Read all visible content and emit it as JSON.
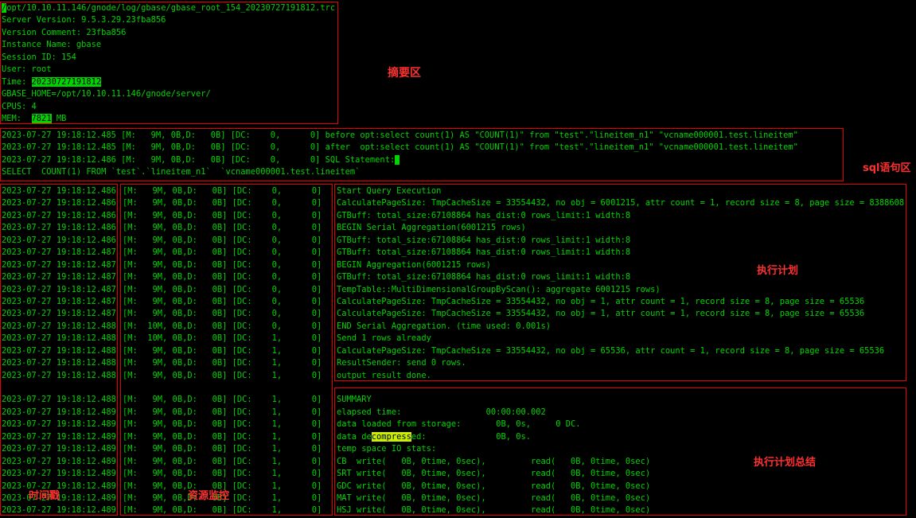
{
  "colors": {
    "bg": "#000000",
    "fg": "#00d400",
    "annotation": "#ff3030",
    "box": "#e80000",
    "highlight": "#c8f000"
  },
  "annotations": {
    "summary_area": "摘要区",
    "sql_area": "sql语句区",
    "exec_plan": "执行计划",
    "exec_plan_summary": "执行计划总结",
    "timestamp": "时间戳",
    "resource_monitor": "资源监控"
  },
  "header": {
    "lines": [
      {
        "segs": [
          [
            "/",
            "inv"
          ],
          [
            "opt/10.10.11.146/gnode/log/gbase/gbase_root_154_20230727191812.trc",
            ""
          ]
        ]
      },
      "Server Version: 9.5.3.29.23fba856",
      "Version Comment: 23fba856",
      "Instance Name: gbase",
      "Session ID: 154",
      "User: root",
      {
        "segs": [
          [
            "Time: ",
            ""
          ],
          [
            "20230727191812",
            "inv"
          ]
        ]
      },
      "GBASE_HOME=/opt/10.10.11.146/gnode/server/",
      "CPUS: 4",
      {
        "segs": [
          [
            "MEM:  ",
            ""
          ],
          [
            "7821",
            "inv"
          ],
          [
            " MB",
            ""
          ]
        ]
      }
    ]
  },
  "sql": {
    "lines": [
      "2023-07-27 19:18:12.485 [M:   9M, 0B,D:   0B] [DC:    0,      0] before opt:select count(1) AS \"COUNT(1)\" from \"test\".\"lineitem_n1\" \"vcname000001.test.lineitem\"",
      "2023-07-27 19:18:12.485 [M:   9M, 0B,D:   0B] [DC:    0,      0] after  opt:select count(1) AS \"COUNT(1)\" from \"test\".\"lineitem_n1\" \"vcname000001.test.lineitem\"",
      {
        "segs": [
          [
            "2023-07-27 19:18:12.486 [M:   9M, 0B,D:   0B] [DC:    0,      0] SQL Statement:",
            ""
          ],
          [
            " ",
            "inv"
          ]
        ]
      },
      "SELECT  COUNT(1) FROM `test`.`lineitem_n1`  `vcname000001.test.lineitem`"
    ]
  },
  "log": {
    "rows": [
      {
        "ts": "2023-07-27 19:18:12.486",
        "res": "[M:   9M, 0B,D:   0B] [DC:    0,      0]",
        "msg": "Start Query Execution"
      },
      {
        "ts": "2023-07-27 19:18:12.486",
        "res": "[M:   9M, 0B,D:   0B] [DC:    0,      0]",
        "msg": "CalculatePageSize: TmpCacheSize = 33554432, no obj = 6001215, attr count = 1, record size = 8, page size = 8388608"
      },
      {
        "ts": "2023-07-27 19:18:12.486",
        "res": "[M:   9M, 0B,D:   0B] [DC:    0,      0]",
        "msg": "GTBuff: total_size:67108864 has_dist:0 rows_limit:1 width:8"
      },
      {
        "ts": "2023-07-27 19:18:12.486",
        "res": "[M:   9M, 0B,D:   0B] [DC:    0,      0]",
        "msg": "BEGIN Serial Aggregation(6001215 rows)"
      },
      {
        "ts": "2023-07-27 19:18:12.486",
        "res": "[M:   9M, 0B,D:   0B] [DC:    0,      0]",
        "msg": "GTBuff: total_size:67108864 has_dist:0 rows_limit:1 width:8"
      },
      {
        "ts": "2023-07-27 19:18:12.487",
        "res": "[M:   9M, 0B,D:   0B] [DC:    0,      0]",
        "msg": "GTBuff: total_size:67108864 has_dist:0 rows_limit:1 width:8"
      },
      {
        "ts": "2023-07-27 19:18:12.487",
        "res": "[M:   9M, 0B,D:   0B] [DC:    0,      0]",
        "msg": "BEGIN Aggregation(6001215 rows)"
      },
      {
        "ts": "2023-07-27 19:18:12.487",
        "res": "[M:   9M, 0B,D:   0B] [DC:    0,      0]",
        "msg": "GTBuff: total_size:67108864 has_dist:0 rows_limit:1 width:8"
      },
      {
        "ts": "2023-07-27 19:18:12.487",
        "res": "[M:   9M, 0B,D:   0B] [DC:    0,      0]",
        "msg": "TempTable::MultiDimensionalGroupByScan(): aggregate 6001215 rows)"
      },
      {
        "ts": "2023-07-27 19:18:12.487",
        "res": "[M:   9M, 0B,D:   0B] [DC:    0,      0]",
        "msg": "CalculatePageSize: TmpCacheSize = 33554432, no obj = 1, attr count = 1, record size = 8, page size = 65536"
      },
      {
        "ts": "2023-07-27 19:18:12.487",
        "res": "[M:   9M, 0B,D:   0B] [DC:    0,      0]",
        "msg": "CalculatePageSize: TmpCacheSize = 33554432, no obj = 1, attr count = 1, record size = 8, page size = 65536"
      },
      {
        "ts": "2023-07-27 19:18:12.488",
        "res": "[M:  10M, 0B,D:   0B] [DC:    0,      0]",
        "msg": "END Serial Aggregation. (time used: 0.001s)"
      },
      {
        "ts": "2023-07-27 19:18:12.488",
        "res": "[M:  10M, 0B,D:   0B] [DC:    1,      0]",
        "msg": "Send 1 rows already"
      },
      {
        "ts": "2023-07-27 19:18:12.488",
        "res": "[M:   9M, 0B,D:   0B] [DC:    1,      0]",
        "msg": "CalculatePageSize: TmpCacheSize = 33554432, no obj = 65536, attr count = 1, record size = 8, page size = 65536"
      },
      {
        "ts": "2023-07-27 19:18:12.488",
        "res": "[M:   9M, 0B,D:   0B] [DC:    1,      0]",
        "msg": "ResultSender: send 0 rows."
      },
      {
        "ts": "2023-07-27 19:18:12.488",
        "res": "[M:   9M, 0B,D:   0B] [DC:    1,      0]",
        "msg": "output result done."
      },
      {
        "ts": "",
        "res": "",
        "msg": ""
      },
      {
        "ts": "2023-07-27 19:18:12.488",
        "res": "[M:   9M, 0B,D:   0B] [DC:    1,      0]",
        "msg": "SUMMARY"
      },
      {
        "ts": "2023-07-27 19:18:12.489",
        "res": "[M:   9M, 0B,D:   0B] [DC:    1,      0]",
        "msg": "elapsed time:                 00:00:00.002"
      },
      {
        "ts": "2023-07-27 19:18:12.489",
        "res": "[M:   9M, 0B,D:   0B] [DC:    1,      0]",
        "msg": "data loaded from storage:       0B, 0s,     0 DC."
      },
      {
        "ts": "2023-07-27 19:18:12.489",
        "res": "[M:   9M, 0B,D:   0B] [DC:    1,      0]",
        "msg": {
          "segs": [
            [
              "data de",
              ""
            ],
            [
              "compress",
              "find"
            ],
            [
              "ed:              0B, 0s.",
              ""
            ]
          ]
        }
      },
      {
        "ts": "2023-07-27 19:18:12.489",
        "res": "[M:   9M, 0B,D:   0B] [DC:    1,      0]",
        "msg": "temp space IO stats:"
      },
      {
        "ts": "2023-07-27 19:18:12.489",
        "res": "[M:   9M, 0B,D:   0B] [DC:    1,      0]",
        "msg": "CB  write(   0B, 0time, 0sec),         read(   0B, 0time, 0sec)"
      },
      {
        "ts": "2023-07-27 19:18:12.489",
        "res": "[M:   9M, 0B,D:   0B] [DC:    1,      0]",
        "msg": "SRT write(   0B, 0time, 0sec),         read(   0B, 0time, 0sec)"
      },
      {
        "ts": "2023-07-27 19:18:12.489",
        "res": "[M:   9M, 0B,D:   0B] [DC:    1,      0]",
        "msg": "GDC write(   0B, 0time, 0sec),         read(   0B, 0time, 0sec)"
      },
      {
        "ts": "2023-07-27 19:18:12.489",
        "res": "[M:   9M, 0B,D:   0B] [DC:    1,      0]",
        "msg": "MAT write(   0B, 0time, 0sec),         read(   0B, 0time, 0sec)"
      },
      {
        "ts": "2023-07-27 19:18:12.489",
        "res": "[M:   9M, 0B,D:   0B] [DC:    1,      0]",
        "msg": "HSJ write(   0B, 0time, 0sec),         read(   0B, 0time, 0sec)"
      }
    ]
  }
}
